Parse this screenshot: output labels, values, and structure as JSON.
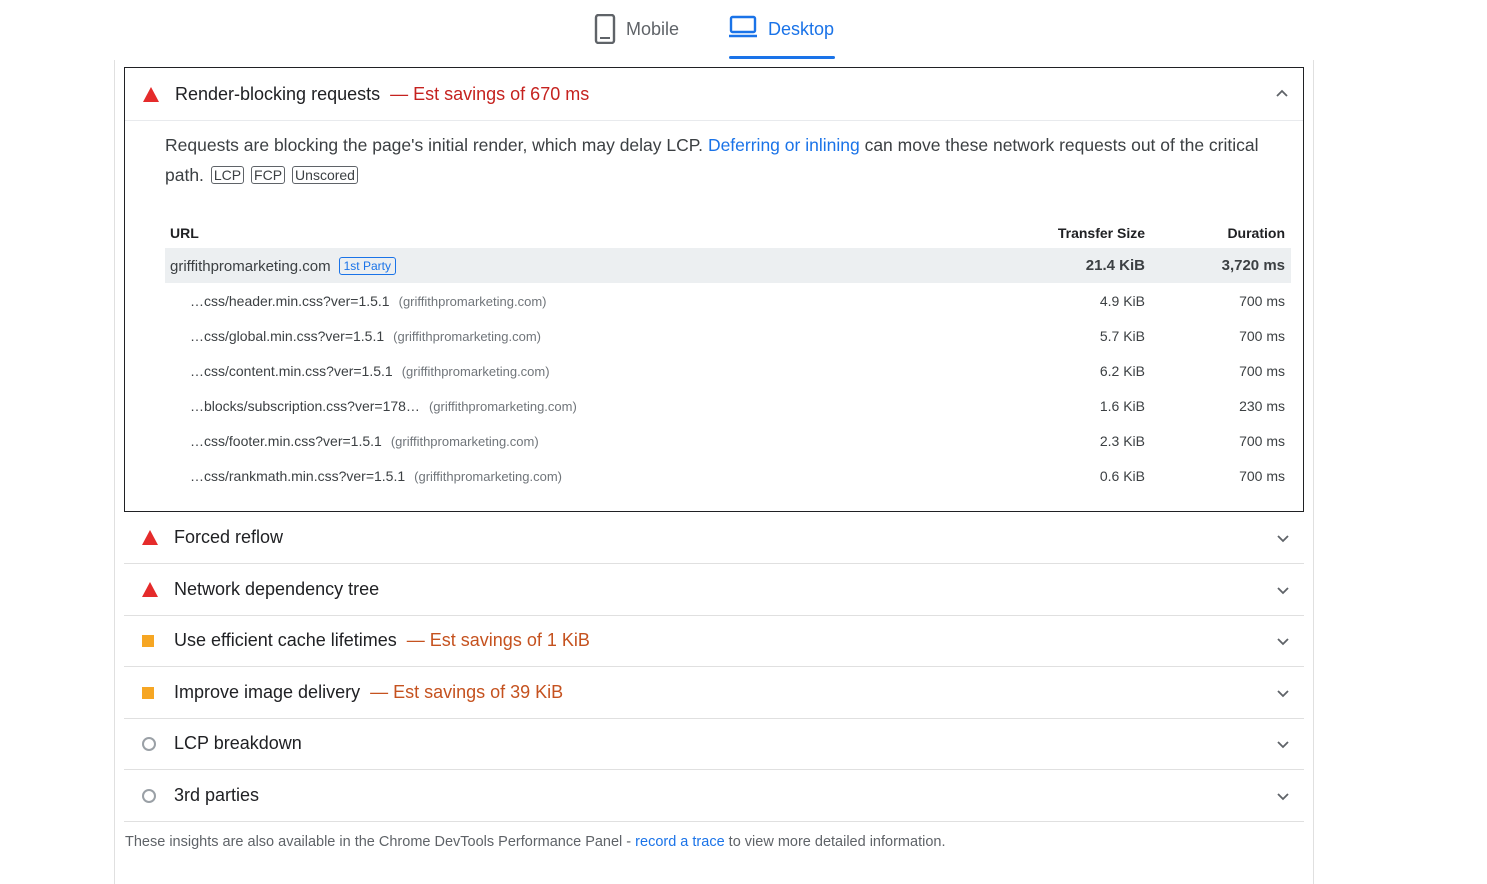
{
  "tabs": {
    "mobile_label": "Mobile",
    "desktop_label": "Desktop",
    "selected": "Desktop"
  },
  "render_blocking": {
    "title": "Render-blocking requests",
    "savings": "— Est savings of 670 ms",
    "description_start": "Requests are blocking the page's initial render, which may delay LCP.",
    "description_link": "Deferring or inlining",
    "description_end": "can move these network requests out of the critical path.",
    "tags": [
      "LCP",
      "FCP",
      "Unscored"
    ],
    "table": {
      "headers": {
        "url": "URL",
        "size": "Transfer Size",
        "duration": "Duration"
      },
      "group": {
        "domain": "griffithpromarketing.com",
        "badge": "1st Party",
        "size": "21.4 KiB",
        "duration": "3,720 ms"
      },
      "rows": [
        {
          "url": "…css/header.min.css?ver=1.5.1",
          "host": "(griffithpromarketing.com)",
          "size": "4.9 KiB",
          "duration": "700 ms"
        },
        {
          "url": "…css/global.min.css?ver=1.5.1",
          "host": "(griffithpromarketing.com)",
          "size": "5.7 KiB",
          "duration": "700 ms"
        },
        {
          "url": "…css/content.min.css?ver=1.5.1",
          "host": "(griffithpromarketing.com)",
          "size": "6.2 KiB",
          "duration": "700 ms"
        },
        {
          "url": "…blocks/subscription.css?ver=178…",
          "host": "(griffithpromarketing.com)",
          "size": "1.6 KiB",
          "duration": "230 ms"
        },
        {
          "url": "…css/footer.min.css?ver=1.5.1",
          "host": "(griffithpromarketing.com)",
          "size": "2.3 KiB",
          "duration": "700 ms"
        },
        {
          "url": "…css/rankmath.min.css?ver=1.5.1",
          "host": "(griffithpromarketing.com)",
          "size": "0.6 KiB",
          "duration": "700 ms"
        }
      ]
    }
  },
  "audits": [
    {
      "title": "Forced reflow",
      "savings": "",
      "status": "fail"
    },
    {
      "title": "Network dependency tree",
      "savings": "",
      "status": "fail"
    },
    {
      "title": "Use efficient cache lifetimes",
      "savings": "— Est savings of 1 KiB",
      "status": "average"
    },
    {
      "title": "Improve image delivery",
      "savings": "— Est savings of 39 KiB",
      "status": "average"
    },
    {
      "title": "LCP breakdown",
      "savings": "",
      "status": "informative"
    },
    {
      "title": "3rd parties",
      "savings": "",
      "status": "informative"
    }
  ],
  "footer": {
    "text_start": "These insights are also available in the Chrome DevTools Performance Panel -",
    "link": "record a trace",
    "text_end": "to view more detailed information."
  },
  "colors": {
    "fail": "#e52b2b",
    "average": "#f6a623",
    "link": "#1a73e8",
    "savings_fail": "#c5221f",
    "savings_average": "#c5521f"
  }
}
